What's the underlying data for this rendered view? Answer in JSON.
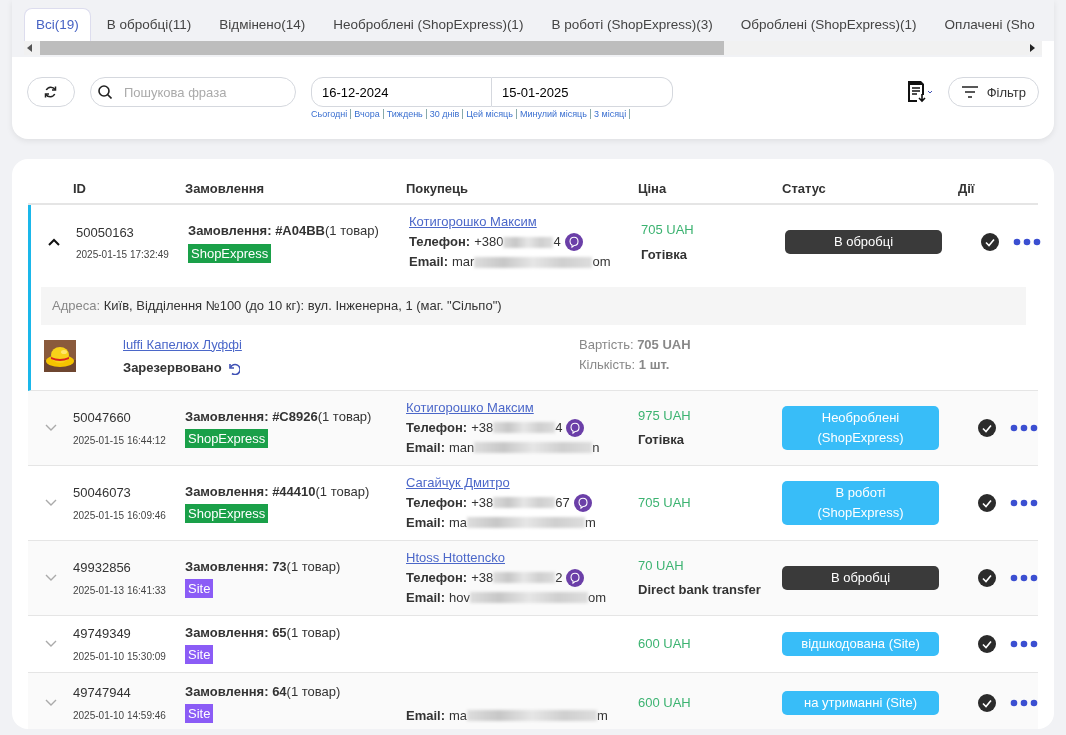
{
  "tabs": [
    {
      "label": "Всі(19)",
      "selected": true
    },
    {
      "label": "В обробці(11)",
      "selected": false
    },
    {
      "label": "Відмінено(14)",
      "selected": false
    },
    {
      "label": "Необроблені (ShopExpress)(1)",
      "selected": false
    },
    {
      "label": "В роботі (ShopExpress)(3)",
      "selected": false
    },
    {
      "label": "Оброблені (ShopExpress)(1)",
      "selected": false
    },
    {
      "label": "Оплачені (Sho",
      "selected": false
    }
  ],
  "toolbar": {
    "search": {
      "placeholder": "Пошукова фраза"
    },
    "date_from": "16-12-2024",
    "date_to": "15-01-2025",
    "quick_dates": [
      "Сьогодні",
      "Вчора",
      "Тиждень",
      "30 днів",
      "Цей місяць",
      "Минулий місяць",
      "3 місяці"
    ],
    "filter_button": "Фільтр"
  },
  "table": {
    "columns": [
      "ID",
      "Замовлення",
      "Покупець",
      "Ціна",
      "Статус",
      "Дії"
    ],
    "rows": [
      {
        "expanded": true,
        "id": "50050163",
        "date": "2025-01-15 17:32:49",
        "order": "**Замовлення: #A04BB**(1 товар)",
        "source": {
          "label": "ShopExpress",
          "color": "#1aa049"
        },
        "buyer": {
          "name": "Котигорошко Максим",
          "phone_label": "Телефон:",
          "phone_start": "+380",
          "phone_end": "4",
          "email_label": "Email:",
          "email_start": "mar",
          "email_end": "om"
        },
        "price": "705 UAH",
        "payment": "Готівка",
        "status": {
          "label": "В обробці",
          "color": "#3a3a3a"
        },
        "details": {
          "address_label": "Адреса:",
          "address": "Київ, Відділення №100 (до 10 кг): вул. Інженерна, 1 (маг. \"Сільпо\")",
          "product": "luffi Капелюх Луффі",
          "reserve": "Зарезервовано",
          "cost": "Вартість: **705 UAH**",
          "quantity": "Кількість: **1 шт.**"
        }
      },
      {
        "expanded": false,
        "id": "50047660",
        "date": "2025-01-15 16:44:12",
        "order": "**Замовлення: #C8926**(1 товар)",
        "source": {
          "label": "ShopExpress",
          "color": "#1aa049"
        },
        "buyer": {
          "name": "Котигорошко Максим",
          "phone_label": "Телефон:",
          "phone_start": "+38",
          "phone_end": "4",
          "email_label": "Email:",
          "email_start": "man",
          "email_end": "n"
        },
        "price": "975 UAH",
        "payment": "Готівка",
        "status": {
          "label": "Необроблені (ShopExpress)",
          "color": "#38bdf8"
        }
      },
      {
        "expanded": false,
        "id": "50046073",
        "date": "2025-01-15 16:09:46",
        "order": "**Замовлення: #44410**(1 товар)",
        "source": {
          "label": "ShopExpress",
          "color": "#1aa049"
        },
        "buyer": {
          "name": "Сагайчук Дмитро",
          "phone_label": "Телефон:",
          "phone_start": "+38",
          "phone_end": "67",
          "email_label": "Email:",
          "email_start": "ma",
          "email_end": "m"
        },
        "price": "705 UAH",
        "status": {
          "label": "В роботі (ShopExpress)",
          "color": "#38bdf8"
        }
      },
      {
        "expanded": false,
        "id": "49932856",
        "date": "2025-01-13 16:41:33",
        "order": "**Замовлення: 73**(1 товар)",
        "source": {
          "label": "Site",
          "color": "#8b5cf6"
        },
        "buyer": {
          "name": "Htoss Htottencko",
          "phone_label": "Телефон:",
          "phone_start": "+38",
          "phone_end": "2",
          "email_label": "Email:",
          "email_start": "hov",
          "email_end": "om"
        },
        "price": "70 UAH",
        "payment": "Direct bank transfer",
        "status": {
          "label": "В обробці",
          "color": "#3a3a3a"
        }
      },
      {
        "expanded": false,
        "id": "49749349",
        "date": "2025-01-10 15:30:09",
        "order": "**Замовлення: 65**(1 товар)",
        "source": {
          "label": "Site",
          "color": "#8b5cf6"
        },
        "buyer": {},
        "price": "600 UAH",
        "status": {
          "label": "відшкодована (Site)",
          "color": "#38bdf8"
        }
      },
      {
        "expanded": false,
        "id": "49747944",
        "date": "2025-01-10 14:59:46",
        "order": "**Замовлення: 64**(1 товар)",
        "source": {
          "label": "Site",
          "color": "#8b5cf6"
        },
        "buyer": {
          "email_label": "Email:",
          "email_start": "ma",
          "email_end": "m"
        },
        "price": "600 UAH",
        "status": {
          "label": "на утриманні (Site)",
          "color": "#38bdf8"
        }
      }
    ]
  }
}
